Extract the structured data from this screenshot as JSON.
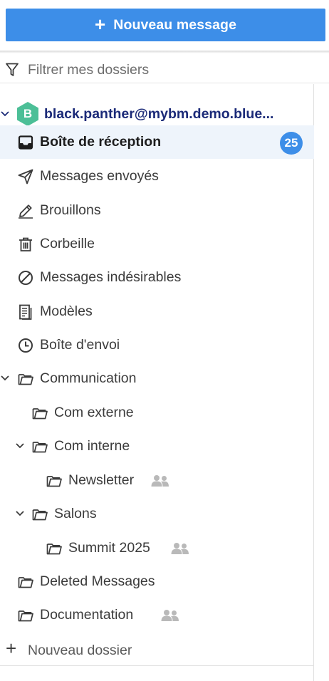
{
  "toolbar": {
    "new_message_label": "Nouveau message"
  },
  "filter": {
    "placeholder": "Filtrer mes dossiers"
  },
  "account": {
    "avatar_letter": "B",
    "email": "black.panther@mybm.demo.blue...",
    "avatar_color": "#4cbf97"
  },
  "folders": {
    "inbox": {
      "label": "Boîte de réception",
      "unread_count": "25"
    },
    "sent": {
      "label": "Messages envoyés"
    },
    "drafts": {
      "label": "Brouillons"
    },
    "trash": {
      "label": "Corbeille"
    },
    "spam": {
      "label": "Messages indésirables"
    },
    "templates": {
      "label": "Modèles"
    },
    "outbox": {
      "label": "Boîte d'envoi"
    },
    "communication": {
      "label": "Communication"
    },
    "com_externe": {
      "label": "Com externe"
    },
    "com_interne": {
      "label": "Com interne"
    },
    "newsletter": {
      "label": "Newsletter",
      "shared": true
    },
    "salons": {
      "label": "Salons"
    },
    "summit": {
      "label": "Summit 2025",
      "shared": true
    },
    "deleted": {
      "label": "Deleted Messages"
    },
    "documentation": {
      "label": "Documentation",
      "shared": true
    }
  },
  "footer": {
    "new_folder_label": "Nouveau dossier"
  },
  "colors": {
    "accent": "#3d8ee8",
    "selected_bg": "#eef4fb",
    "account_text": "#1b2a78"
  }
}
